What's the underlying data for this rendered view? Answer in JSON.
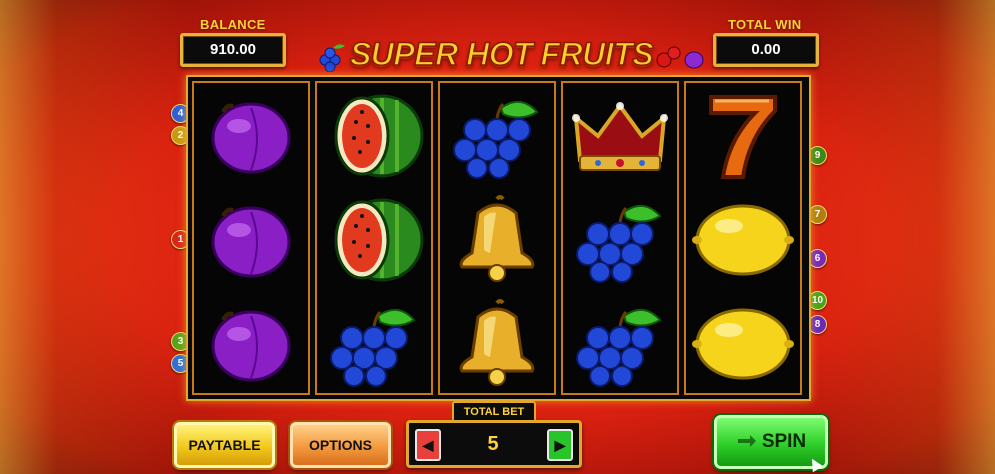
{
  "header": {
    "balance_label": "BALANCE",
    "balance_value": "910.00",
    "total_win_label": "TOTAL WIN",
    "total_win_value": "0.00",
    "logo_text": "SUPER HOT FRUITS"
  },
  "reels": [
    [
      "plum",
      "plum",
      "plum"
    ],
    [
      "watermelon",
      "watermelon",
      "grapes"
    ],
    [
      "grapes",
      "bell",
      "bell"
    ],
    [
      "crown",
      "grapes",
      "grapes"
    ],
    [
      "seven",
      "lemon",
      "lemon"
    ]
  ],
  "paylines": {
    "left": [
      "4",
      "2",
      "1",
      "3",
      "5"
    ],
    "right": [
      "9",
      "7",
      "6",
      "10",
      "8"
    ]
  },
  "controls": {
    "paytable_label": "PAYTABLE",
    "options_label": "OPTIONS",
    "total_bet_label": "TOTAL BET",
    "bet_value": "5",
    "bet_decrease_icon": "arrow-left-icon",
    "bet_increase_icon": "arrow-right-icon",
    "spin_label": "SPIN",
    "spin_icon": "spin-arrows-icon"
  },
  "colors": {
    "gold": "#ffd23a",
    "frame_gold": "#e3a82c",
    "spin_green": "#2ecf2a",
    "arrow_red": "#e8403a",
    "arrow_green": "#28c42a"
  }
}
